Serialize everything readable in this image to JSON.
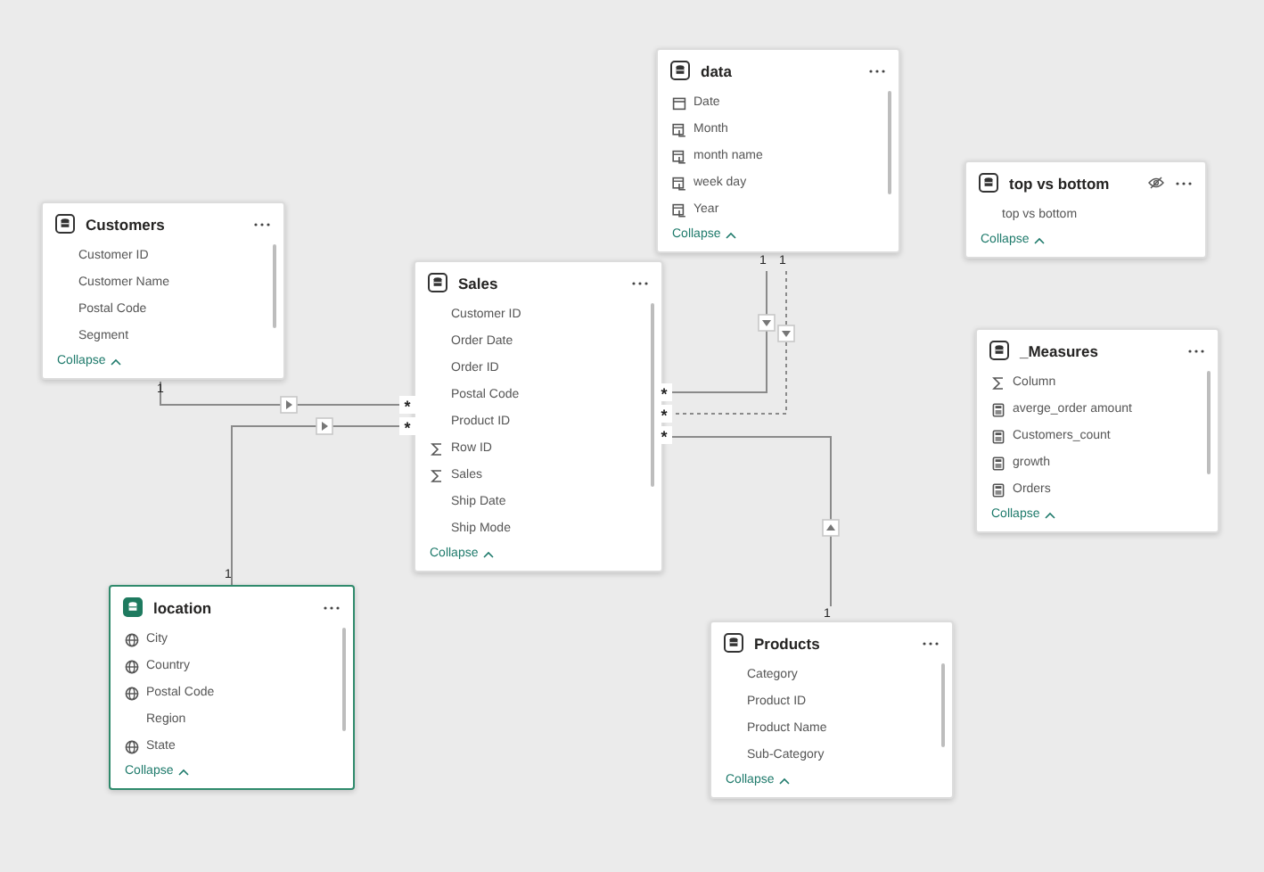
{
  "tables": [
    {
      "title": "data",
      "selected": false,
      "hidden": false,
      "collapse": "Collapse",
      "fields": [
        {
          "name": "Date",
          "kind": "calendar"
        },
        {
          "name": "Month",
          "kind": "hierarchy"
        },
        {
          "name": "month name",
          "kind": "hierarchy"
        },
        {
          "name": "week day",
          "kind": "hierarchy"
        },
        {
          "name": "Year",
          "kind": "hierarchy"
        }
      ]
    },
    {
      "title": "top vs bottom",
      "selected": false,
      "hidden": true,
      "collapse": "Collapse",
      "fields": [
        {
          "name": "top vs bottom",
          "kind": "plain"
        }
      ]
    },
    {
      "title": "Customers",
      "selected": false,
      "hidden": false,
      "collapse": "Collapse",
      "fields": [
        {
          "name": "Customer ID",
          "kind": "plain"
        },
        {
          "name": "Customer Name",
          "kind": "plain"
        },
        {
          "name": "Postal Code",
          "kind": "plain"
        },
        {
          "name": "Segment",
          "kind": "plain"
        }
      ]
    },
    {
      "title": "Sales",
      "selected": false,
      "hidden": false,
      "collapse": "Collapse",
      "fields": [
        {
          "name": "Customer ID",
          "kind": "plain"
        },
        {
          "name": "Order Date",
          "kind": "plain"
        },
        {
          "name": "Order ID",
          "kind": "plain"
        },
        {
          "name": "Postal Code",
          "kind": "plain"
        },
        {
          "name": "Product ID",
          "kind": "plain"
        },
        {
          "name": "Row ID",
          "kind": "sum"
        },
        {
          "name": "Sales",
          "kind": "sum"
        },
        {
          "name": "Ship Date",
          "kind": "plain"
        },
        {
          "name": "Ship Mode",
          "kind": "plain"
        }
      ]
    },
    {
      "title": "_Measures",
      "selected": false,
      "hidden": false,
      "collapse": "Collapse",
      "fields": [
        {
          "name": "Column",
          "kind": "sum"
        },
        {
          "name": "averge_order amount",
          "kind": "calc"
        },
        {
          "name": "Customers_count",
          "kind": "calc"
        },
        {
          "name": "growth",
          "kind": "calc"
        },
        {
          "name": "Orders",
          "kind": "calc"
        }
      ]
    },
    {
      "title": "location",
      "selected": true,
      "hidden": false,
      "collapse": "Collapse",
      "fields": [
        {
          "name": "City",
          "kind": "globe"
        },
        {
          "name": "Country",
          "kind": "globe"
        },
        {
          "name": "Postal Code",
          "kind": "globe"
        },
        {
          "name": "Region",
          "kind": "plain"
        },
        {
          "name": "State",
          "kind": "globe"
        }
      ]
    },
    {
      "title": "Products",
      "selected": false,
      "hidden": false,
      "collapse": "Collapse",
      "fields": [
        {
          "name": "Category",
          "kind": "plain"
        },
        {
          "name": "Product ID",
          "kind": "plain"
        },
        {
          "name": "Product Name",
          "kind": "plain"
        },
        {
          "name": "Sub-Category",
          "kind": "plain"
        }
      ]
    }
  ],
  "relationships": [
    {
      "one_label": "1",
      "many_label": "*",
      "active": true
    },
    {
      "one_label": "1",
      "many_label": "*",
      "active": true
    },
    {
      "one_label": "1",
      "many_label": "*",
      "active": true
    },
    {
      "one_label": "1",
      "many_label": "*",
      "active": false
    },
    {
      "one_label": "1",
      "many_label": "*",
      "active": true
    }
  ]
}
